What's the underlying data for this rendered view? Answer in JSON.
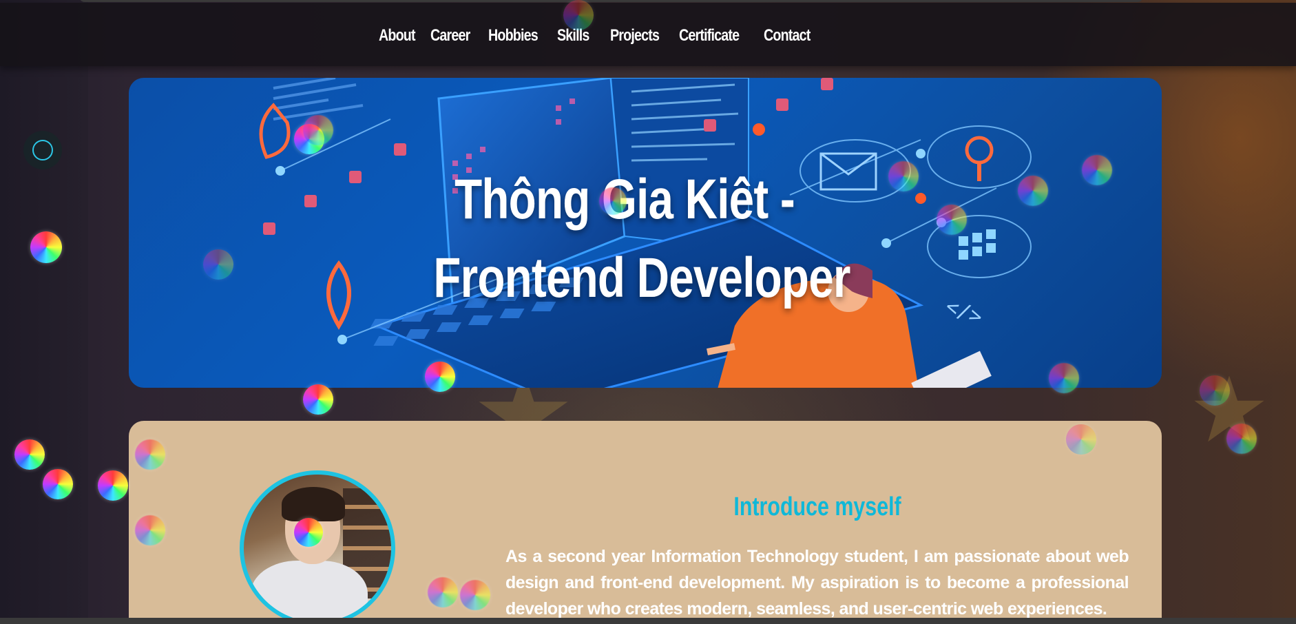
{
  "nav": {
    "items": [
      {
        "label": "About"
      },
      {
        "label": "Career"
      },
      {
        "label": "Hobbies"
      },
      {
        "label": "Skills"
      },
      {
        "label": "Projects"
      },
      {
        "label": "Certificate"
      },
      {
        "label": "Contact"
      }
    ]
  },
  "hero": {
    "title_line1": "Thông Gia Kiêt -",
    "title_line2": "Frontend Developer"
  },
  "intro": {
    "heading": "Introduce myself",
    "text": "As a second year Information Technology student, I am passionate about web design and front-end development. My aspiration is to become a professional developer who creates modern, seamless, and user-centric web experiences."
  },
  "icons": {
    "side_toggle": "circle-toggle-icon",
    "decorations": "rainbow-bubble-icon"
  },
  "colors": {
    "accent": "#1ec3e2",
    "nav_bg": "#161218",
    "hero_bg": "#0a5bbd",
    "card_bg": "#d8bc98"
  }
}
